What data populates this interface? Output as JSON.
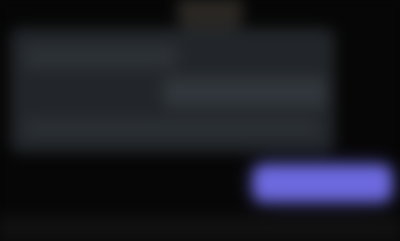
{
  "app": {
    "title": ""
  },
  "ui": {
    "panel_text": "",
    "primary_button_label": ""
  },
  "colors": {
    "background": "#060606",
    "panel": "#22262a",
    "accent": "#6c69de"
  }
}
